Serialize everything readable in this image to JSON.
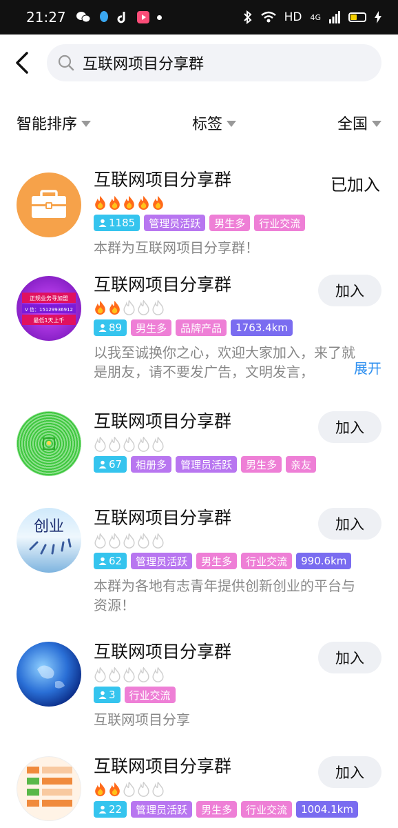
{
  "status_bar": {
    "time": "21:27",
    "network": "HD",
    "signal": "4G"
  },
  "search": {
    "query": "互联网项目分享群"
  },
  "filters": [
    {
      "label": "智能排序"
    },
    {
      "label": "标签"
    },
    {
      "label": "全国"
    }
  ],
  "groups": [
    {
      "name": "互联网项目分享群",
      "action": "已加入",
      "fire_level": 5,
      "count": "1185",
      "tags": [
        "管理员活跃",
        "男生多",
        "行业交流"
      ],
      "distance": "",
      "description": "本群为互联网项目分享群！",
      "avatar": "briefcase-icon"
    },
    {
      "name": "互联网项目分享群",
      "action": "加入",
      "fire_level": 2,
      "count": "89",
      "tags": [
        "男生多",
        "品牌产品"
      ],
      "distance": "1763.4km",
      "description_lines": [
        "以我至诚换你之心，欢迎大家加入，来了就",
        "是朋友，请不要发广告，文明发言，"
      ],
      "expand": "展开",
      "avatar_text": [
        "正规业务寻加盟",
        "V 信：15129936912",
        "最低1天上千"
      ]
    },
    {
      "name": "互联网项目分享群",
      "action": "加入",
      "fire_level": 0,
      "count": "67",
      "tags": [
        "相册多",
        "管理员活跃",
        "男生多",
        "亲友"
      ],
      "distance": ""
    },
    {
      "name": "互联网项目分享群",
      "action": "加入",
      "fire_level": 0,
      "count": "62",
      "tags": [
        "管理员活跃",
        "男生多",
        "行业交流"
      ],
      "distance": "990.6km",
      "description_lines": [
        "本群为各地有志青年提供创新创业的平台与",
        "资源！"
      ],
      "avatar_text": [
        "创业"
      ]
    },
    {
      "name": "互联网项目分享群",
      "action": "加入",
      "fire_level": 0,
      "count": "3",
      "tags": [
        "行业交流"
      ],
      "distance": "",
      "description": "互联网项目分享"
    },
    {
      "name": "互联网项目分享群",
      "action": "加入",
      "fire_level": 2,
      "count": "22",
      "tags": [
        "管理员活跃",
        "男生多",
        "行业交流"
      ],
      "distance": "1004.1km"
    }
  ],
  "colors": {
    "count_tag": "#35c4ee",
    "purple_tag": "#b876f0",
    "pink_tag": "#ee7fd6",
    "distance_tag": "#7a6cf0",
    "expand_link": "#2d8ff0"
  }
}
